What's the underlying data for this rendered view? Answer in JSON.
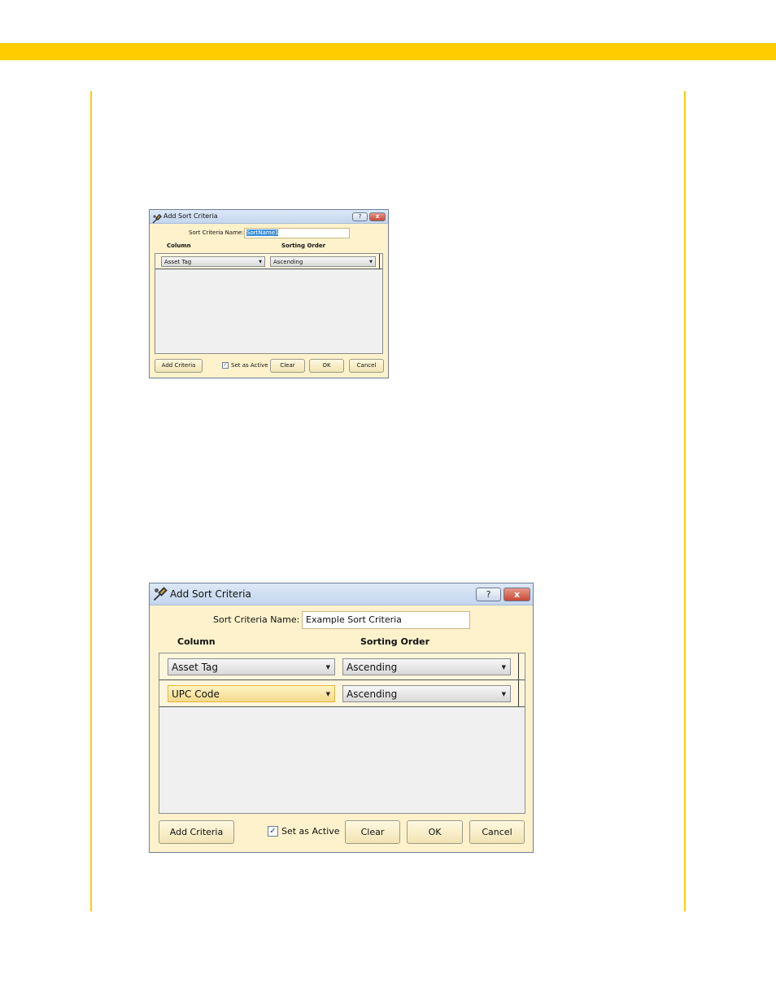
{
  "page": {
    "accent_color": "#ffcc00"
  },
  "dialog_small": {
    "title": "Add Sort Criteria",
    "help_label": "?",
    "close_label": "x",
    "name_label": "Sort Criteria Name:",
    "name_value": "SortName1",
    "column_header": "Column",
    "order_header": "Sorting Order",
    "rows": [
      {
        "column": "Asset Tag",
        "order": "Ascending"
      }
    ],
    "add_criteria_label": "Add Criteria",
    "set_active_label": "Set as Active",
    "set_active_checked": true,
    "clear_label": "Clear",
    "ok_label": "OK",
    "cancel_label": "Cancel"
  },
  "dialog_large": {
    "title": "Add Sort Criteria",
    "help_label": "?",
    "close_label": "x",
    "name_label": "Sort Criteria Name:",
    "name_value": "Example Sort Criteria",
    "column_header": "Column",
    "order_header": "Sorting Order",
    "rows": [
      {
        "column": "Asset Tag",
        "order": "Ascending"
      },
      {
        "column": "UPC Code",
        "order": "Ascending"
      }
    ],
    "add_criteria_label": "Add Criteria",
    "set_active_label": "Set as Active",
    "set_active_checked": true,
    "clear_label": "Clear",
    "ok_label": "OK",
    "cancel_label": "Cancel"
  }
}
